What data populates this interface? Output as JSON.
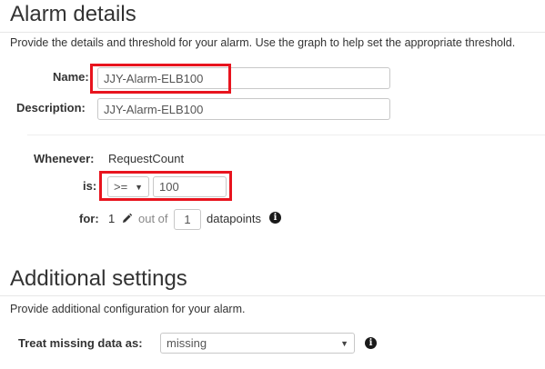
{
  "alarm_details": {
    "title": "Alarm details",
    "description": "Provide the details and threshold for your alarm. Use the graph to help set the appropriate threshold.",
    "name_label": "Name:",
    "name_value": "JJY-Alarm-ELB100",
    "description_label": "Description:",
    "description_value": "JJY-Alarm-ELB100",
    "whenever_label": "Whenever:",
    "whenever_value": "RequestCount",
    "is_label": "is:",
    "operator_value": ">=",
    "threshold_value": "100",
    "for_label": "for:",
    "for_count": "1",
    "out_of_text": "out of",
    "datapoints_value": "1",
    "datapoints_text": "datapoints"
  },
  "additional_settings": {
    "title": "Additional settings",
    "description": "Provide additional configuration for your alarm.",
    "missing_data_label": "Treat missing data as:",
    "missing_data_value": "missing"
  },
  "icons": {
    "info": "info-icon",
    "edit": "pencil-icon",
    "dropdown": "chevron-down-icon"
  },
  "colors": {
    "highlight": "#e8141e",
    "text": "#333333",
    "border": "#c8c8c8"
  }
}
